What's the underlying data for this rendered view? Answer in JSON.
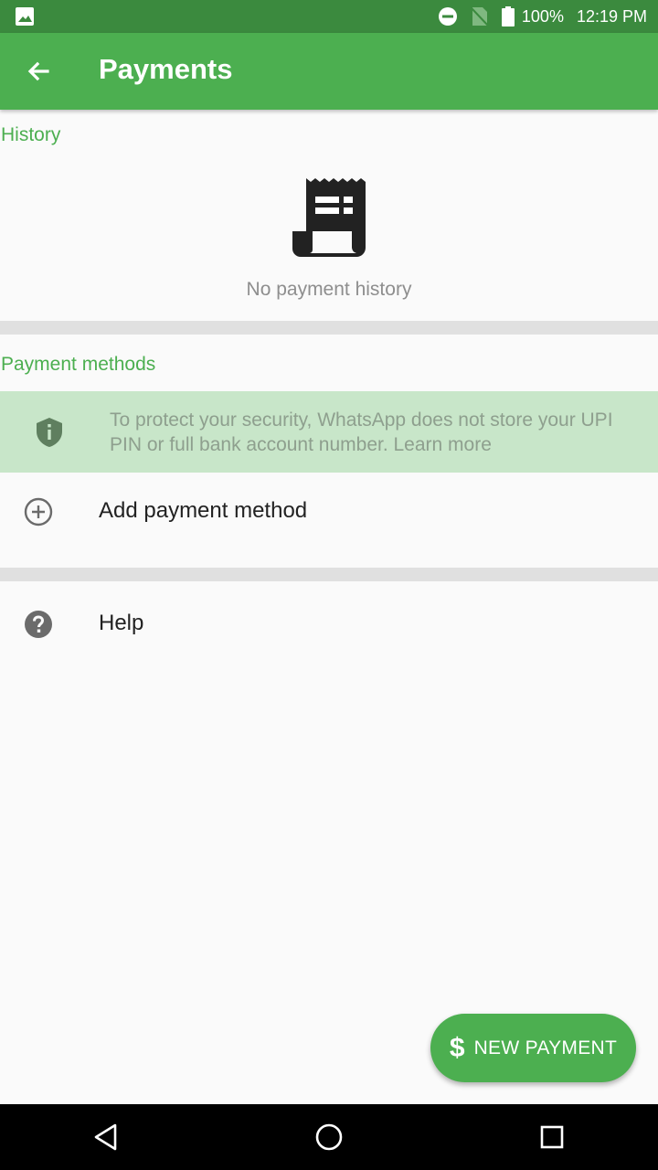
{
  "status_bar": {
    "battery": "100%",
    "time": "12:19 PM",
    "icons": [
      "gallery-icon",
      "do-not-disturb-icon",
      "no-sim-icon",
      "battery-icon"
    ]
  },
  "app_bar": {
    "title": "Payments",
    "back_icon": "arrow-back-icon"
  },
  "history": {
    "label": "History",
    "empty_icon": "receipt-icon",
    "empty_text": "No payment history"
  },
  "payment_methods": {
    "label": "Payment methods",
    "security_text": "To protect your security, WhatsApp does not store your UPI PIN or full bank account number. Learn more",
    "add_label": "Add payment method"
  },
  "help": {
    "label": "Help"
  },
  "fab": {
    "symbol": "$",
    "label": "NEW PAYMENT"
  },
  "colors": {
    "status_bar": "#3b8a3e",
    "primary": "#4caf50",
    "banner": "#c8e6c9"
  }
}
